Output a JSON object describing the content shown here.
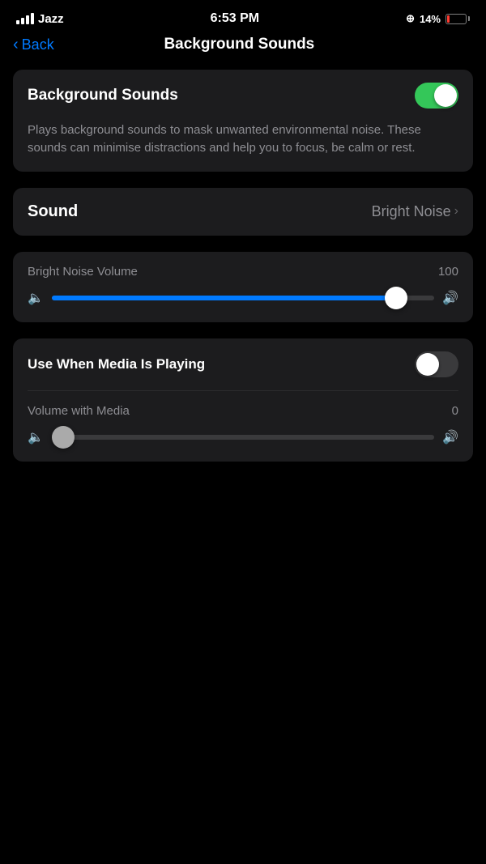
{
  "status_bar": {
    "carrier": "Jazz",
    "time": "6:53 PM",
    "battery_percent": "14%"
  },
  "nav": {
    "back_label": "Back",
    "title": "Background Sounds"
  },
  "background_sounds_card": {
    "toggle_label": "Background Sounds",
    "toggle_state": "on",
    "description": "Plays background sounds to mask unwanted environmental noise. These sounds can minimise distractions and help you to focus, be calm or rest."
  },
  "sound_card": {
    "label": "Sound",
    "value": "Bright Noise"
  },
  "volume_card": {
    "title": "Bright Noise Volume",
    "value": "100",
    "fill_percent": "90"
  },
  "media_card": {
    "toggle_label": "Use When Media Is Playing",
    "toggle_state": "off",
    "volume_title": "Volume with Media",
    "volume_value": "0",
    "fill_percent": "0"
  }
}
